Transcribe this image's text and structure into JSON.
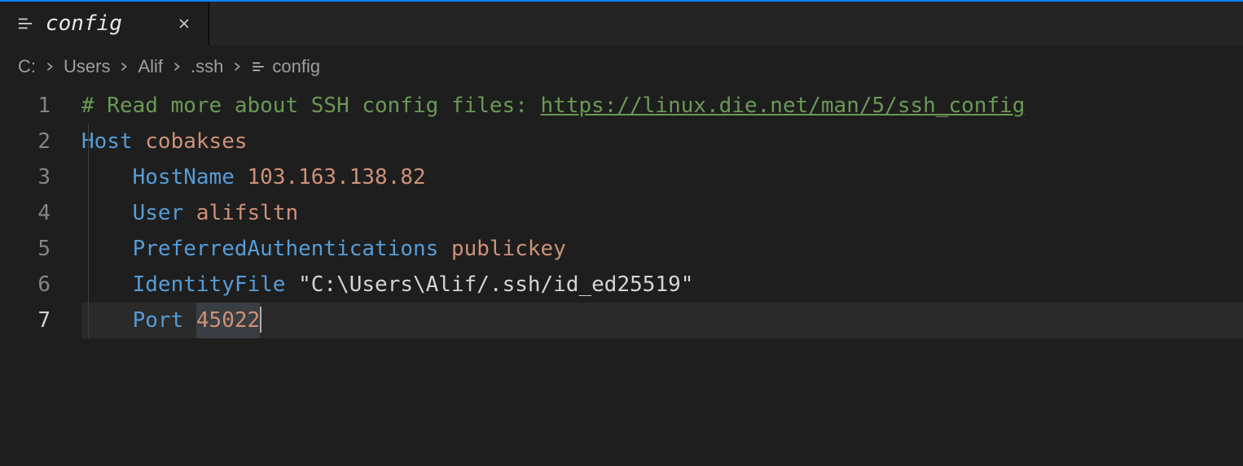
{
  "tab": {
    "label": "config"
  },
  "breadcrumb": {
    "segments": [
      "C:",
      "Users",
      "Alif",
      ".ssh"
    ],
    "filename": "config"
  },
  "editor": {
    "active_line": 7,
    "lines": [
      {
        "n": 1,
        "tokens": [
          {
            "cls": "tok-comment",
            "t": "# Read more about SSH config files: "
          },
          {
            "cls": "tok-link",
            "t": "https://linux.die.net/man/5/ssh_config"
          }
        ],
        "indent": 0
      },
      {
        "n": 2,
        "tokens": [
          {
            "cls": "tok-keyword",
            "t": "Host"
          },
          {
            "cls": "",
            "t": " "
          },
          {
            "cls": "tok-value",
            "t": "cobakses"
          }
        ],
        "indent": 0
      },
      {
        "n": 3,
        "tokens": [
          {
            "cls": "tok-keyword",
            "t": "HostName"
          },
          {
            "cls": "",
            "t": " "
          },
          {
            "cls": "tok-value",
            "t": "103.163.138.82"
          }
        ],
        "indent": 1
      },
      {
        "n": 4,
        "tokens": [
          {
            "cls": "tok-keyword",
            "t": "User"
          },
          {
            "cls": "",
            "t": " "
          },
          {
            "cls": "tok-value",
            "t": "alifsltn"
          }
        ],
        "indent": 1
      },
      {
        "n": 5,
        "tokens": [
          {
            "cls": "tok-keyword",
            "t": "PreferredAuthentications"
          },
          {
            "cls": "",
            "t": " "
          },
          {
            "cls": "tok-value",
            "t": "publickey"
          }
        ],
        "indent": 1
      },
      {
        "n": 6,
        "tokens": [
          {
            "cls": "tok-keyword",
            "t": "IdentityFile"
          },
          {
            "cls": "",
            "t": " "
          },
          {
            "cls": "tok-string",
            "t": "\"C:\\Users\\Alif/.ssh/id_ed25519\""
          }
        ],
        "indent": 1
      },
      {
        "n": 7,
        "tokens": [
          {
            "cls": "tok-keyword",
            "t": "Port"
          },
          {
            "cls": "",
            "t": " "
          },
          {
            "cls": "tok-value sel",
            "t": "45022"
          }
        ],
        "indent": 1,
        "cursor_after": true
      }
    ]
  }
}
